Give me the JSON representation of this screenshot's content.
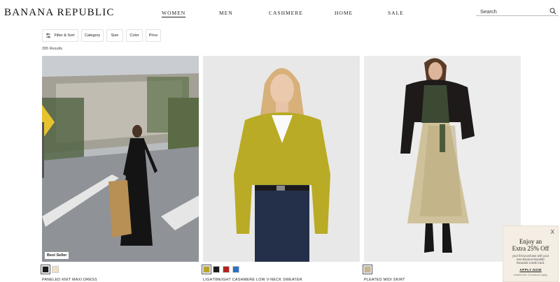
{
  "header": {
    "logo": "BANANA REPUBLIC",
    "nav": [
      {
        "label": "WOMEN",
        "active": true
      },
      {
        "label": "MEN",
        "active": false
      },
      {
        "label": "CASHMERE",
        "active": false
      },
      {
        "label": "HOME",
        "active": false
      },
      {
        "label": "SALE",
        "active": false
      }
    ],
    "search_placeholder": "Search"
  },
  "filters": {
    "buttons": [
      "Filter & Sort",
      "Category",
      "Size",
      "Color",
      "Price"
    ],
    "results": "395 Results"
  },
  "products": [
    {
      "name": "PANELED KNIT MAXI DRESS",
      "badge": "Best Seller",
      "swatches": [
        "#1d1a1a",
        "#efe0c2"
      ]
    },
    {
      "name": "LIGHTWEIGHT CASHMERE LOW V-NECK SWEATER",
      "badge": "",
      "swatches": [
        "#b8a22a",
        "#1b1b1b",
        "#b3221f",
        "#2f6fc0"
      ]
    },
    {
      "name": "PLEATED MIDI SKIRT",
      "badge": "",
      "swatches": [
        "#cbb58a"
      ]
    }
  ],
  "promo": {
    "close": "X",
    "title_1": "Enjoy an",
    "title_2": "Extra 25% Off",
    "body": "your first purchase with your new Banana Republic Rewards Credit Card.",
    "cta": "APPLY NOW",
    "terms": "Limited time. Exclusions apply."
  },
  "colors": {
    "brand_text": "#111111",
    "promo_bg": "#f4eee4"
  }
}
